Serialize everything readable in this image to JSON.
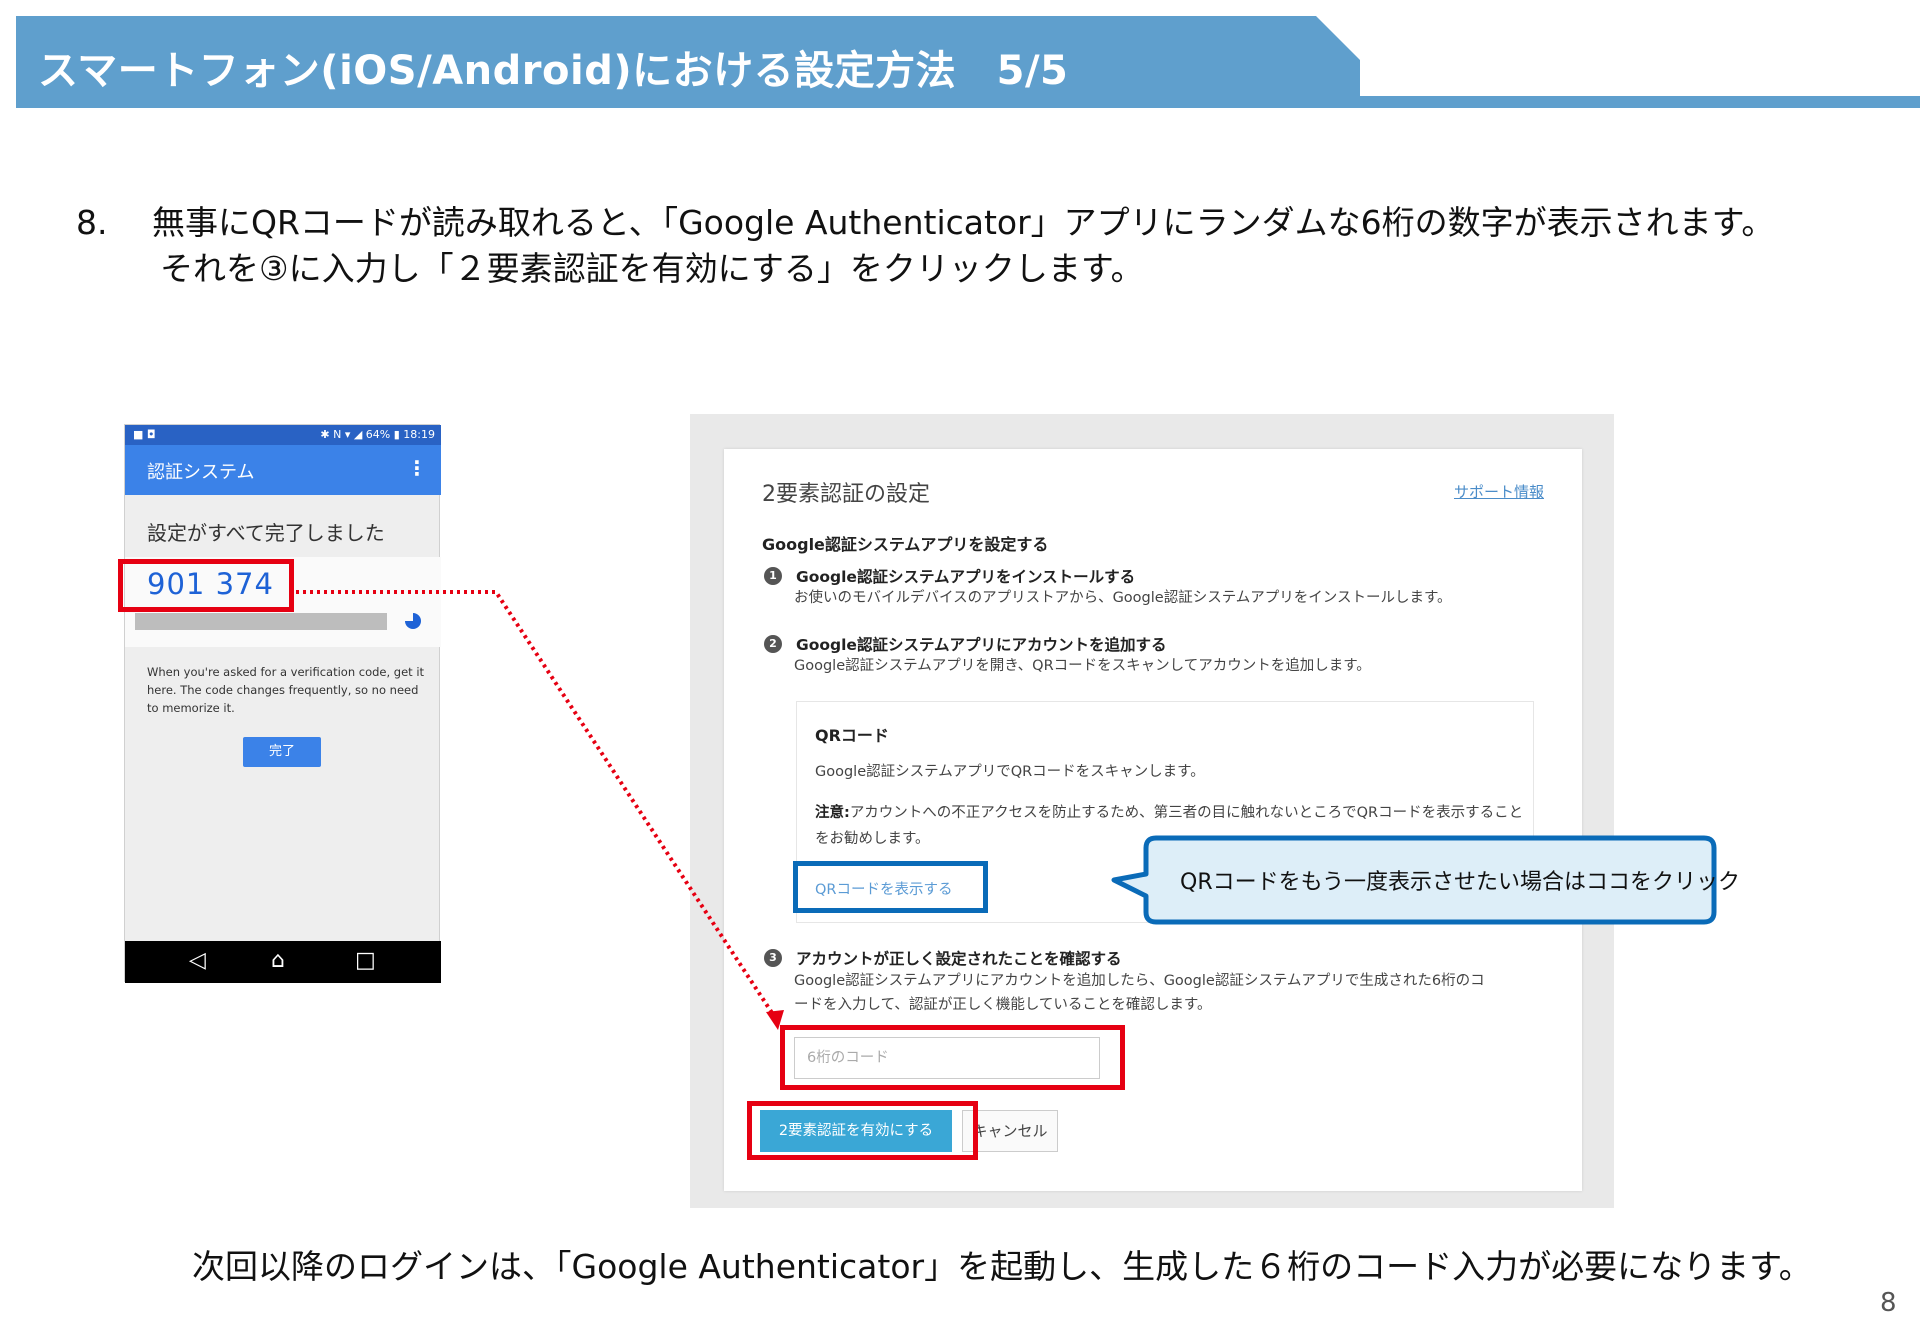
{
  "header": {
    "title": "スマートフォン(iOS/Android)における設定方法　5/5"
  },
  "instruction": {
    "number": "8.",
    "line1": "無事にQRコードが読み取れると、「Google Authenticator」アプリにランダムな6桁の数字が表示されます。",
    "line2": "それを③に入力し「２要素認証を有効にする」をクリックします。"
  },
  "phone": {
    "status_left": "■ ◘",
    "status_right": "✱ N ▾ ◢ 64% ▮ 18:19",
    "app_title": "認証システム",
    "menu_icon": "⋮",
    "done_text": "設定がすべて完了しました",
    "code": "901 374",
    "help_text": "When you're asked for a verification code, get it here. The code changes frequently, so no need to memorize it.",
    "ok_button": "完了",
    "nav_back": "◁",
    "nav_home": "⌂",
    "nav_recent": "□"
  },
  "panel": {
    "title": "2要素認証の設定",
    "support_link": "サポート情報",
    "subtitle": "Google認証システムアプリを設定する",
    "step1": {
      "num": "1",
      "title": "Google認証システムアプリをインストールする",
      "desc": "お使いのモバイルデバイスのアプリストアから、Google認証システムアプリをインストールします。"
    },
    "step2": {
      "num": "2",
      "title": "Google認証システムアプリにアカウントを追加する",
      "desc": "Google認証システムアプリを開き、QRコードをスキャンしてアカウントを追加します。"
    },
    "qr": {
      "title": "QRコード",
      "desc": "Google認証システムアプリでQRコードをスキャンします。",
      "note_label": "注意:",
      "note_text": "アカウントへの不正アクセスを防止するため、第三者の目に触れないところでQRコードを表示することをお勧めします。",
      "show_link": "QRコードを表示する"
    },
    "step3": {
      "num": "3",
      "title": "アカウントが正しく設定されたことを確認する",
      "desc_line1": "Google認証システムアプリにアカウントを追加したら、Google認証システムアプリで生成された6桁のコ",
      "desc_line2": "ードを入力して、認証が正しく機能していることを確認します。"
    },
    "code_placeholder": "6桁のコード",
    "enable_button": "2要素認証を有効にする",
    "cancel_button": "キャンセル"
  },
  "callout": {
    "text": "QRコードをもう一度表示させたい場合はココをクリック"
  },
  "footer": {
    "text": "次回以降のログインは、「Google Authenticator」を起動し、生成した６桁のコード入力が必要になります。",
    "page_number": "8"
  },
  "colors": {
    "header_blue": "#5f9fcd",
    "highlight_red": "#e60012",
    "highlight_blue": "#0a6bb8",
    "callout_fill": "#ddeef8"
  }
}
